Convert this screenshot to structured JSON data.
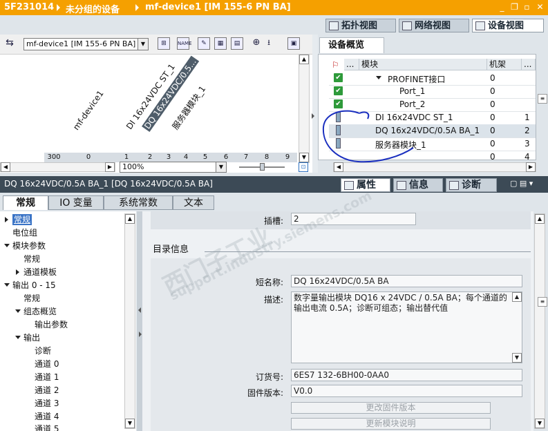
{
  "titlebar": {
    "crumbs": [
      "5F231014",
      "未分组的设备",
      "mf-device1 [IM 155-6 PN BA]"
    ],
    "controls": [
      "_",
      "❐",
      "▫",
      "✕"
    ]
  },
  "view_tabs": [
    {
      "label": "拓扑视图",
      "active": false
    },
    {
      "label": "网络视图",
      "active": false
    },
    {
      "label": "设备视图",
      "active": true
    }
  ],
  "canvas": {
    "device_select": "mf-device1 [IM 155-6 PN BA]",
    "zoom": "100%",
    "labels": {
      "device": "mf-device1",
      "module1": "DI 16x24VDC ST_1",
      "module2": "DQ 16x24VDC/0.5...",
      "module3": "服务器模块_1"
    },
    "ruler": [
      "300",
      "0",
      "1",
      "2",
      "3",
      "4",
      "5",
      "6",
      "7",
      "8",
      "9"
    ]
  },
  "overview": {
    "tab": "设备概览",
    "columns": [
      "模块",
      "机架",
      "..."
    ],
    "rows": [
      {
        "module": "PROFINET接口",
        "rack": "0",
        "slot": "",
        "status": "ok",
        "indent": 1
      },
      {
        "module": "Port_1",
        "rack": "0",
        "slot": "",
        "status": "ok",
        "indent": 2
      },
      {
        "module": "Port_2",
        "rack": "0",
        "slot": "",
        "status": "ok",
        "indent": 2
      },
      {
        "module": "DI 16x24VDC ST_1",
        "rack": "0",
        "slot": "1",
        "status": "module",
        "indent": 0
      },
      {
        "module": "DQ 16x24VDC/0.5A BA_1",
        "rack": "0",
        "slot": "2",
        "status": "module",
        "indent": 0
      },
      {
        "module": "服务器模块_1",
        "rack": "0",
        "slot": "3",
        "status": "module",
        "indent": 0
      },
      {
        "module": "",
        "rack": "0",
        "slot": "4",
        "status": "",
        "indent": 0
      }
    ]
  },
  "inspector": {
    "title": "DQ 16x24VDC/0.5A BA_1 [DQ 16x24VDC/0.5A BA]",
    "tabs": [
      {
        "label": "属性",
        "active": true
      },
      {
        "label": "信息",
        "active": false
      },
      {
        "label": "诊断",
        "active": false
      }
    ],
    "subtabs": [
      "常规",
      "IO 变量",
      "系统常数",
      "文本"
    ],
    "nav": [
      {
        "label": "常规",
        "level": 0,
        "arrow": "right",
        "selected": true
      },
      {
        "label": "电位组",
        "level": 0,
        "arrow": "",
        "selected": false
      },
      {
        "label": "模块参数",
        "level": 0,
        "arrow": "down",
        "selected": false
      },
      {
        "label": "常规",
        "level": 1,
        "arrow": "",
        "selected": false
      },
      {
        "label": "通道模板",
        "level": 1,
        "arrow": "right",
        "selected": false
      },
      {
        "label": "输出 0 - 15",
        "level": 0,
        "arrow": "down",
        "selected": false
      },
      {
        "label": "常规",
        "level": 1,
        "arrow": "",
        "selected": false
      },
      {
        "label": "组态概览",
        "level": 1,
        "arrow": "down",
        "selected": false
      },
      {
        "label": "输出参数",
        "level": 2,
        "arrow": "",
        "selected": false
      },
      {
        "label": "输出",
        "level": 1,
        "arrow": "down",
        "selected": false
      },
      {
        "label": "诊断",
        "level": 2,
        "arrow": "",
        "selected": false
      },
      {
        "label": "通道 0",
        "level": 2,
        "arrow": "",
        "selected": false
      },
      {
        "label": "通道 1",
        "level": 2,
        "arrow": "",
        "selected": false
      },
      {
        "label": "通道 2",
        "level": 2,
        "arrow": "",
        "selected": false
      },
      {
        "label": "通道 3",
        "level": 2,
        "arrow": "",
        "selected": false
      },
      {
        "label": "通道 4",
        "level": 2,
        "arrow": "",
        "selected": false
      },
      {
        "label": "通道 5",
        "level": 2,
        "arrow": "",
        "selected": false
      }
    ],
    "props": {
      "slot_label": "插槽:",
      "slot_value": "2",
      "section": "目录信息",
      "short_name_label": "短名称:",
      "short_name": "DQ 16x24VDC/0.5A BA",
      "desc_label": "描述:",
      "description": "数字量输出模块 DQ16 x 24VDC / 0.5A BA；每个通道的输出电流 0.5A；诊断可组态；输出替代值",
      "order_label": "订货号:",
      "order_no": "6ES7 132-6BH00-0AA0",
      "fw_label": "固件版本:",
      "fw": "V0.0",
      "btn_update_fw": "更改固件版本",
      "btn_update_desc": "更新模块说明"
    }
  },
  "watermark": {
    "line1": "西门子工业",
    "line2": "support.industry.siemens.com"
  },
  "colors": {
    "titlebar": "#f5a000",
    "ok_green": "#2e9a3a",
    "annotation": "#1a2fbf"
  }
}
